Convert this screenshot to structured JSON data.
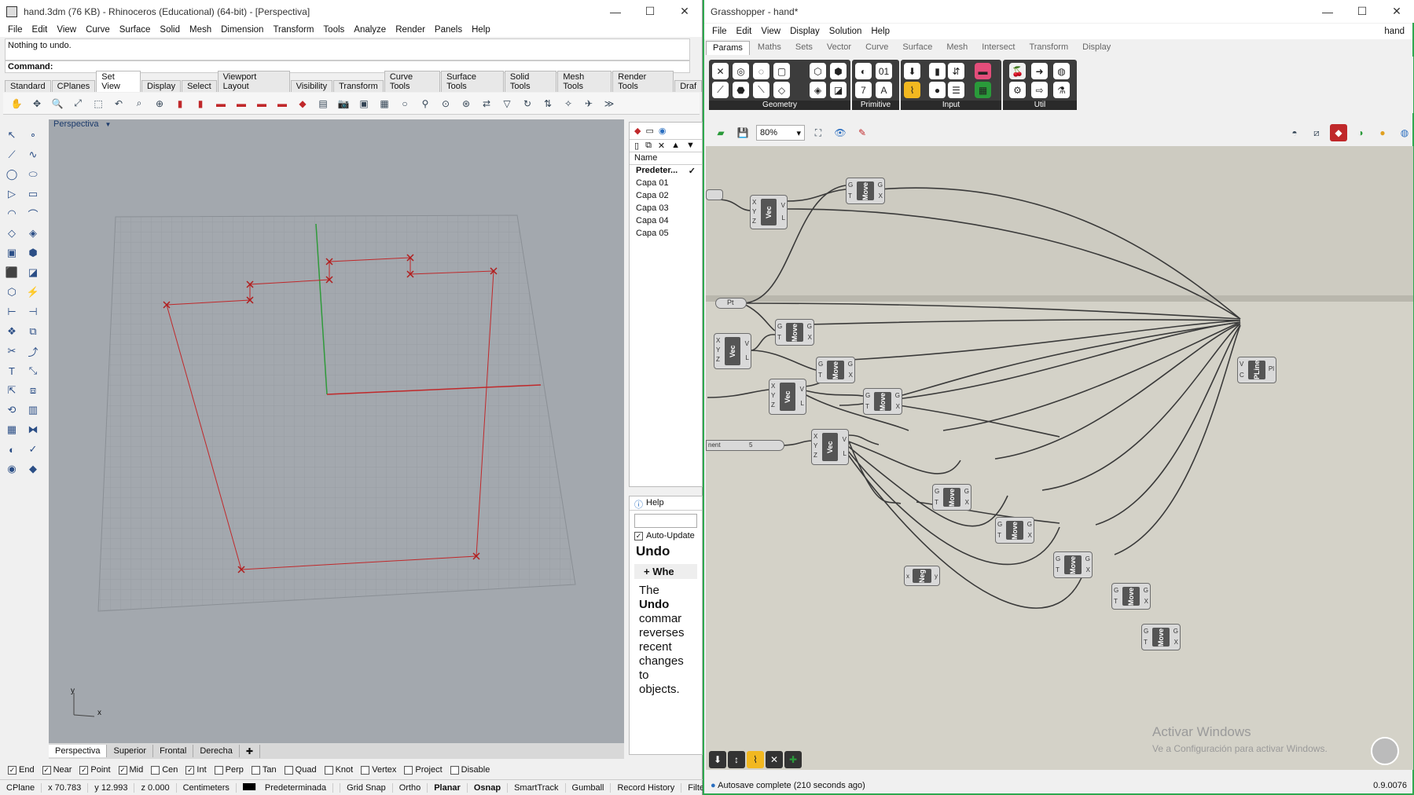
{
  "rhino": {
    "title": "hand.3dm (76 KB) - Rhinoceros (Educational) (64-bit) - [Perspectiva]",
    "menu": [
      "File",
      "Edit",
      "View",
      "Curve",
      "Surface",
      "Solid",
      "Mesh",
      "Dimension",
      "Transform",
      "Tools",
      "Analyze",
      "Render",
      "Panels",
      "Help"
    ],
    "history": "Nothing to undo.",
    "command_label": "Command:",
    "tabs": [
      "Standard",
      "CPlanes",
      "Set View",
      "Display",
      "Select",
      "Viewport Layout",
      "Visibility",
      "Transform",
      "Curve Tools",
      "Surface Tools",
      "Solid Tools",
      "Mesh Tools",
      "Render Tools",
      "Draf"
    ],
    "active_tab": "Set View",
    "viewport_label": "Perspectiva",
    "view_tabs": [
      "Perspectiva",
      "Superior",
      "Frontal",
      "Derecha"
    ],
    "axis_y": "y",
    "axis_x": "x",
    "layers": {
      "header": "Name",
      "items": [
        "Predeter...",
        "Capa 01",
        "Capa 02",
        "Capa 03",
        "Capa 04",
        "Capa 05"
      ],
      "current_check": "✓"
    },
    "help": {
      "tab": "Help",
      "auto_update": "Auto-Update",
      "title": "Undo",
      "when": "+ Whe",
      "body_lines": [
        "The",
        "Undo",
        "commar",
        "reverses",
        "recent",
        "changes",
        "to",
        "objects."
      ]
    },
    "osnaps": [
      {
        "label": "End",
        "checked": true
      },
      {
        "label": "Near",
        "checked": true
      },
      {
        "label": "Point",
        "checked": true
      },
      {
        "label": "Mid",
        "checked": true
      },
      {
        "label": "Cen",
        "checked": false
      },
      {
        "label": "Int",
        "checked": true
      },
      {
        "label": "Perp",
        "checked": false
      },
      {
        "label": "Tan",
        "checked": false
      },
      {
        "label": "Quad",
        "checked": false
      },
      {
        "label": "Knot",
        "checked": false
      },
      {
        "label": "Vertex",
        "checked": false
      },
      {
        "label": "Project",
        "checked": false
      },
      {
        "label": "Disable",
        "checked": false
      }
    ],
    "status": {
      "cplane": "CPlane",
      "x": "x 70.783",
      "y": "y 12.993",
      "z": "z 0.000",
      "units": "Centimeters",
      "layer": "Predeterminada",
      "grid_snap": "Grid Snap",
      "ortho": "Ortho",
      "planar": "Planar",
      "osnap": "Osnap",
      "smarttrack": "SmartTrack",
      "gumball": "Gumball",
      "record_history": "Record History",
      "filter": "Filter"
    }
  },
  "grasshopper": {
    "title": "Grasshopper - hand*",
    "doc_name": "hand",
    "menu": [
      "File",
      "Edit",
      "View",
      "Display",
      "Solution",
      "Help"
    ],
    "tabs": [
      "Params",
      "Maths",
      "Sets",
      "Vector",
      "Curve",
      "Surface",
      "Mesh",
      "Intersect",
      "Transform",
      "Display"
    ],
    "active_tab": "Params",
    "groups": [
      "Geometry",
      "Primitive",
      "Input",
      "Util"
    ],
    "zoom": "80%",
    "components": [
      {
        "id": "vec1",
        "label": "Vec",
        "in": [
          "X",
          "Y",
          "Z"
        ],
        "out": [
          "V",
          "L"
        ]
      },
      {
        "id": "move1",
        "label": "Move",
        "in": [
          "G",
          "T"
        ],
        "out": [
          "G",
          "X"
        ]
      },
      {
        "id": "pt",
        "label": "Pt"
      },
      {
        "id": "move2",
        "label": "Move",
        "in": [
          "G",
          "T"
        ],
        "out": [
          "G",
          "X"
        ]
      },
      {
        "id": "vec2",
        "label": "Vec",
        "in": [
          "X",
          "Y",
          "Z"
        ],
        "out": [
          "V",
          "L"
        ]
      },
      {
        "id": "move3",
        "label": "Move",
        "in": [
          "G",
          "T"
        ],
        "out": [
          "G",
          "X"
        ]
      },
      {
        "id": "vec3",
        "label": "Vec",
        "in": [
          "X",
          "Y",
          "Z"
        ],
        "out": [
          "V",
          "L"
        ]
      },
      {
        "id": "move4",
        "label": "Move",
        "in": [
          "G",
          "T"
        ],
        "out": [
          "G",
          "X"
        ]
      },
      {
        "id": "slider",
        "label": "nent",
        "value": "5"
      },
      {
        "id": "vec4",
        "label": "Vec",
        "in": [
          "X",
          "Y",
          "Z"
        ],
        "out": [
          "V",
          "L"
        ]
      },
      {
        "id": "move5",
        "label": "Move",
        "in": [
          "G",
          "T"
        ],
        "out": [
          "G",
          "X"
        ]
      },
      {
        "id": "move6",
        "label": "Move",
        "in": [
          "G",
          "T"
        ],
        "out": [
          "G",
          "X"
        ]
      },
      {
        "id": "neg",
        "label": "Neg",
        "in": [
          "x"
        ],
        "out": [
          "y"
        ]
      },
      {
        "id": "move7",
        "label": "Move",
        "in": [
          "G",
          "T"
        ],
        "out": [
          "G",
          "X"
        ]
      },
      {
        "id": "move8",
        "label": "Move",
        "in": [
          "G",
          "T"
        ],
        "out": [
          "G",
          "X"
        ]
      },
      {
        "id": "move9",
        "label": "Move",
        "in": [
          "G",
          "T"
        ],
        "out": [
          "G",
          "X"
        ]
      },
      {
        "id": "plline",
        "label": "PLine",
        "in": [
          "V",
          "C"
        ],
        "out": [
          "Pl"
        ]
      }
    ],
    "watermark_title": "Activar Windows",
    "watermark_sub": "Ve a Configuración para activar Windows.",
    "status": "Autosave complete (210 seconds ago)",
    "version": "0.9.0076"
  },
  "colors": {
    "rhino_curve": "#c0282a",
    "gh_canvas": "#d4d2c8",
    "gh_frame": "#2fa84f",
    "x_axis": "#c0282a",
    "y_axis": "#2f9a3a"
  }
}
